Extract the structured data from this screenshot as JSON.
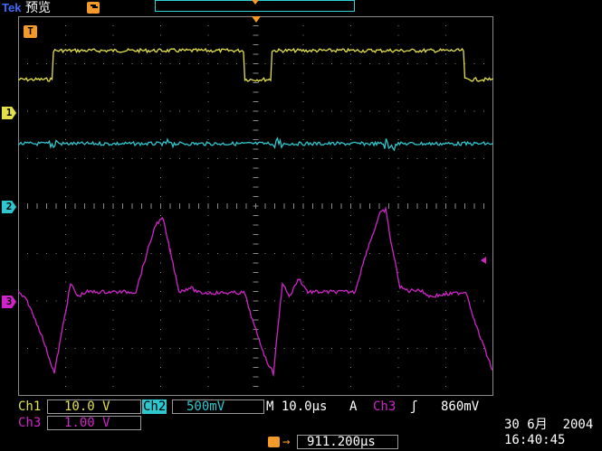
{
  "header": {
    "brand": "Tek",
    "mode": "预览"
  },
  "channels": [
    {
      "id": "ch1",
      "label": "Ch1",
      "scale": "10.0 V",
      "marker": "1",
      "color": "#e3e04a"
    },
    {
      "id": "ch2",
      "label": "Ch2",
      "scale": "500mV",
      "marker": "2",
      "color": "#2fc7cf"
    },
    {
      "id": "ch3",
      "label": "Ch3",
      "scale": "1.00 V",
      "marker": "3",
      "color": "#d024c9"
    }
  ],
  "timebase": "M 10.0µs",
  "trigger": {
    "mode": "A",
    "source": "Ch3",
    "slope_symbol": "ʃ",
    "level": "860mV",
    "position": "911.200µs",
    "marker": "T",
    "color": "#f39a2b"
  },
  "datetime": {
    "date": "30 6月  2004",
    "time": "16:40:45"
  },
  "display": {
    "grid": "on",
    "background": "#000000",
    "grid_color": "#8a8a8a"
  }
}
